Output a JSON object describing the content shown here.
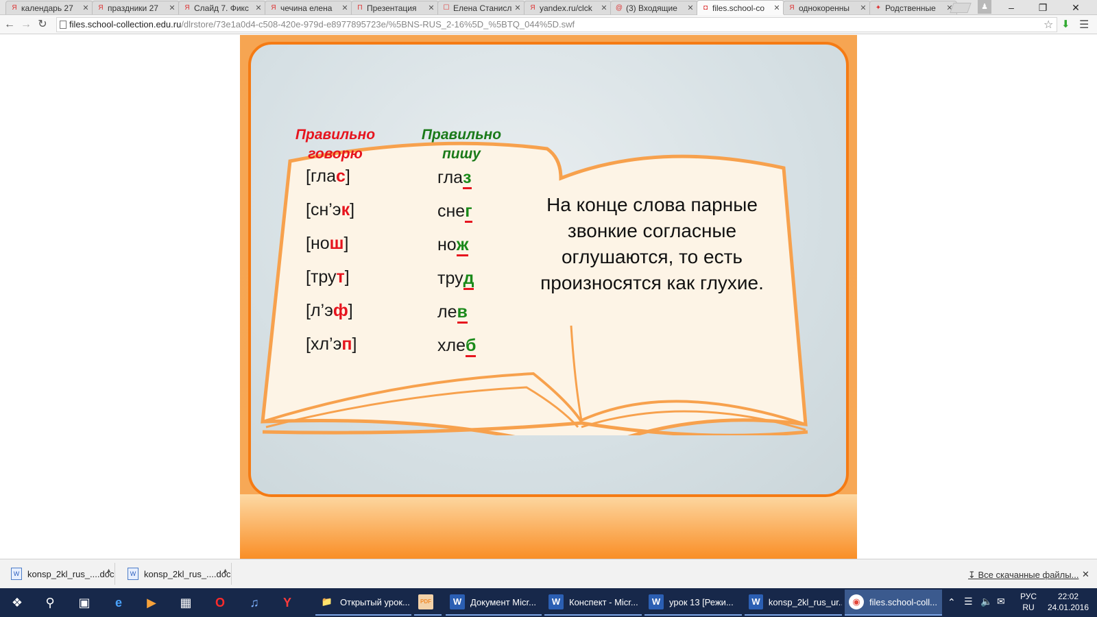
{
  "browser": {
    "tabs": [
      {
        "label": "календарь 27",
        "favicon": "Я"
      },
      {
        "label": "праздники 27",
        "favicon": "Я"
      },
      {
        "label": "Слайд 7. Фикс",
        "favicon": "Я"
      },
      {
        "label": "чечина елена",
        "favicon": "Я"
      },
      {
        "label": "Презентация",
        "favicon": "П"
      },
      {
        "label": "Елена Станисл",
        "favicon": "☐"
      },
      {
        "label": "yandex.ru/clck",
        "favicon": "Я"
      },
      {
        "label": "(3) Входящие",
        "favicon": "@"
      },
      {
        "label": "files.school-co",
        "favicon": "◘"
      },
      {
        "label": "однокоренны",
        "favicon": "Я"
      },
      {
        "label": "Родственные",
        "favicon": "✦"
      }
    ],
    "active_tab_index": 8,
    "url_host": "files.school-collection.edu.ru",
    "url_path": "/dlrstore/73e1a0d4-c508-420e-979d-e8977895723e/%5BNS-RUS_2-16%5D_%5BTQ_044%5D.swf"
  },
  "slide": {
    "head_spoken_1": "Правильно",
    "head_spoken_2": "говорю",
    "head_written_1": "Правильно",
    "head_written_2": "пишу",
    "rows": [
      {
        "spoken_pre": "[гла",
        "spoken_hl": "с",
        "spoken_post": "]",
        "written_pre": "гла",
        "written_hl": "з"
      },
      {
        "spoken_pre": "[сн’э",
        "spoken_hl": "к",
        "spoken_post": "]",
        "written_pre": "сне",
        "written_hl": "г"
      },
      {
        "spoken_pre": "[но",
        "spoken_hl": "ш",
        "spoken_post": "]",
        "written_pre": "но",
        "written_hl": "ж"
      },
      {
        "spoken_pre": "[тру",
        "spoken_hl": "т",
        "spoken_post": "]",
        "written_pre": "тру",
        "written_hl": "д"
      },
      {
        "spoken_pre": "[л’э",
        "spoken_hl": "ф",
        "spoken_post": "]",
        "written_pre": "ле",
        "written_hl": "в"
      },
      {
        "spoken_pre": "[хл’э",
        "spoken_hl": "п",
        "spoken_post": "]",
        "written_pre": "хле",
        "written_hl": "б"
      }
    ],
    "rule_text": "На конце слова парные звонкие согласные оглушаются, то есть произносятся как глухие."
  },
  "downloads": {
    "items": [
      "konsp_2kl_rus_....doc",
      "konsp_2kl_rus_....doc"
    ],
    "all_files": "Все скачанные файлы..."
  },
  "taskbar": {
    "apps": [
      {
        "label": "Открытый урок...",
        "icon": "folder-icon"
      },
      {
        "label": "",
        "icon": "pdf-icon"
      },
      {
        "label": "Документ Micr...",
        "icon": "word-icon"
      },
      {
        "label": "Конспект - Micr...",
        "icon": "word-icon"
      },
      {
        "label": "урок 13 [Режи...",
        "icon": "word-icon"
      },
      {
        "label": "konsp_2kl_rus_ur...",
        "icon": "word-icon"
      },
      {
        "label": "files.school-coll...",
        "icon": "chrome-icon"
      }
    ],
    "lang_1": "РУС",
    "lang_2": "RU",
    "time": "22:02",
    "date": "24.01.2016"
  }
}
